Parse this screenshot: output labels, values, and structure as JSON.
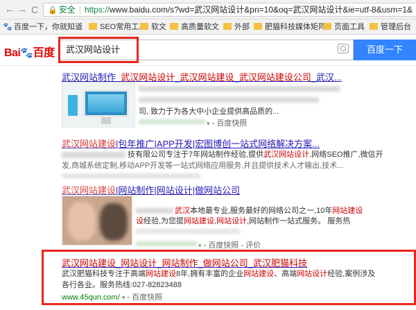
{
  "browser": {
    "back_glyph": "←",
    "forward_glyph": "→",
    "reload_glyph": "C",
    "lock_glyph": "🔒",
    "secure_label": "安全",
    "url_protocol": "https://",
    "url_rest": "www.baidu.com/s?wd=武汉网站设计&pn=10&oq=武汉网站设计&ie=utf-8&usm=1&"
  },
  "bookmarks": [
    {
      "label": "百度一下，你就知道",
      "icon": "baidu-paw-icon"
    },
    {
      "label": "SEO常用工具",
      "icon": "folder-icon"
    },
    {
      "label": "软文",
      "icon": "folder-icon"
    },
    {
      "label": "高质量软文",
      "icon": "folder-icon"
    },
    {
      "label": "外部",
      "icon": "folder-icon"
    },
    {
      "label": "肥猫科技媒体矩阵",
      "icon": "folder-icon"
    },
    {
      "label": "页面工具",
      "icon": "folder-icon"
    },
    {
      "label": "管理后台",
      "icon": "folder-icon"
    }
  ],
  "logo": {
    "part1": "Bai",
    "paw": "🐾",
    "part2": "百度"
  },
  "search": {
    "query": "武汉网站设计",
    "button_label": "百度一下"
  },
  "results": [
    {
      "title_parts": [
        "武汉网站制作_",
        "武汉网站设计",
        "_",
        "武汉网站建设",
        "_",
        "武汉网站建设公司",
        "_武汉..."
      ],
      "line3": "司, 致力于为各大中小企业提供高品质的...",
      "snapshot": "百度快照"
    },
    {
      "title_em": "武汉网站建设",
      "title_rest": "|包年推广|APP开发|宏图博创一站式网络解决方案...",
      "line1_a": "技有限公司专注于7年网站制作经验,提供",
      "line1_em": "武汉网站设计",
      "line1_b": ",网络SEO推广,微信开",
      "line2": "发,商城系统定制,移动APP开发等一站式网络应用服务,并且提供技术人才输出,技术..."
    },
    {
      "title_em": "武汉网站建设",
      "title_rest": "|网站制作|网站设计|做网站公司",
      "line1_em1": "武汉",
      "line1_a": "本地最专业,服务最好的网络公司之一,10年",
      "line1_em2": "网站建设",
      "line2_em1": "设",
      "line2_a": "经验,为您提",
      "line2_em2": "网站建设",
      "line2_b": ",",
      "line2_em3": "网站设计",
      "line2_c": ",网站制作一站式服务。 服务热",
      "snapshot": "百度快照",
      "extra": "- 评价"
    },
    {
      "title_parts": [
        "武汉网站建设",
        "_",
        "网站设计",
        "_",
        "网站制作",
        "_",
        "做网站公司",
        "_",
        "武汉肥猫科技"
      ],
      "line1_a": "武汉肥猫科技专注于高端",
      "line1_em1": "网站建设",
      "line1_b": "8年,拥有丰富的企业",
      "line1_em2": "网站建设",
      "line1_c": "、高端",
      "line1_em3": "网站设计",
      "line1_d": "经验,案例涉及",
      "line2": "各行各业。服务热线:027-82823488",
      "url": "www.45qun.com/",
      "arrow": "▾",
      "snapshot": "百度快照"
    }
  ]
}
